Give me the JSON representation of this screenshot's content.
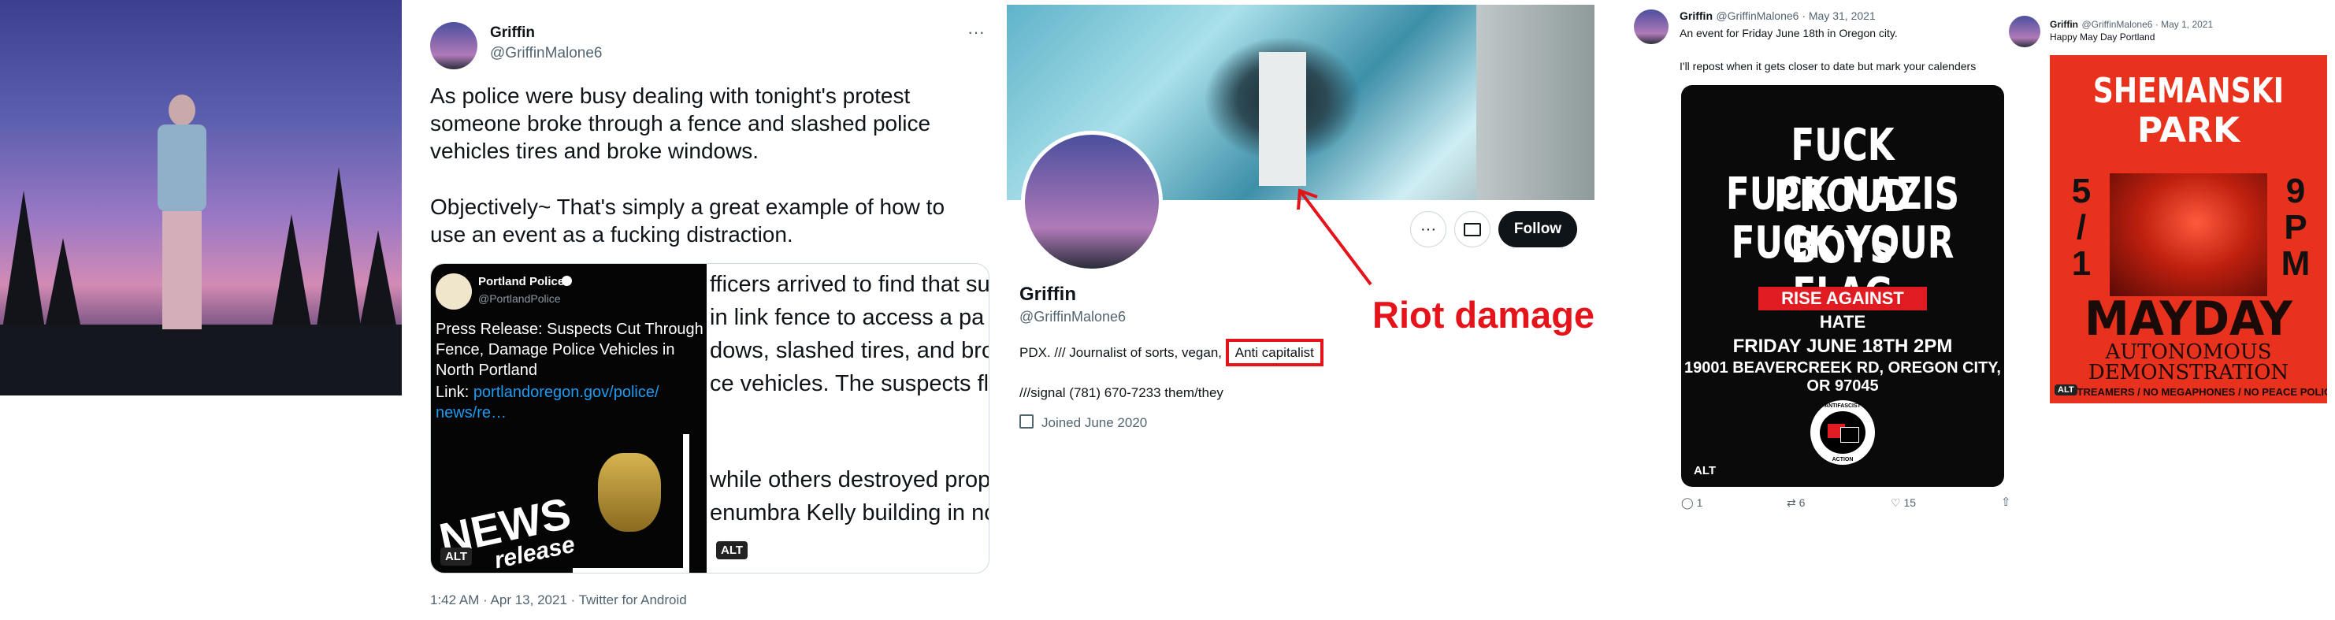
{
  "tweet": {
    "name": "Griffin",
    "handle": "@GriffinMalone6",
    "more": "···",
    "text1": "As police were busy dealing with tonight's protest someone broke through a fence and slashed police vehicles tires and broke windows.",
    "text2": "Objectively~ That's simply a great example of how to use an event as a fucking distraction.",
    "timestamp": "1:42 AM · Apr 13, 2021 · Twitter for Android",
    "embedded": {
      "name": "Portland Police",
      "handle": "@PortlandPolice",
      "title": "Press Release: Suspects Cut Through Fence, Damage Police Vehicles in North Portland",
      "link_label": "Link:",
      "link": "portlandoregon.gov/police/ news/re…",
      "news_word": "NEWS",
      "release_word": "release",
      "alt": "ALT"
    },
    "side_lines": [
      "fficers arrived to find that su",
      "in link fence to access a pa",
      "dows, slashed tires, and bro",
      "ce vehicles. The suspects fle",
      "while others destroyed prop",
      "enumbra Kelly building in no"
    ],
    "alt2": "ALT"
  },
  "profile": {
    "name": "Griffin",
    "handle": "@GriffinMalone6",
    "bio_prefix": "PDX. /// Journalist of sorts, vegan,",
    "bio_highlight": "Anti capitalist",
    "contact": "///signal (781) 670-7233 them/they",
    "joined": "Joined June 2020",
    "follow_label": "Follow",
    "more": "···",
    "annotation": "Riot damage"
  },
  "tweet2": {
    "name": "Griffin",
    "handle_date": "@GriffinMalone6 · May 31, 2021",
    "line1": "An event for Friday June 18th in Oregon city.",
    "line2": "I'll repost when it gets closer to date but mark your calenders",
    "poster": {
      "l1": "FUCK PROUD BOYS",
      "l2": "FUCK NAZIS",
      "l3": "FUCK YOUR FLAG",
      "banner": "RISE AGAINST HATE",
      "date": "FRIDAY JUNE 18TH 2PM",
      "address": "19001 BEAVERCREEK RD, OREGON CITY, OR 97045",
      "logo_top": "ANTIFASCIST",
      "logo_bottom": "ACTION",
      "alt": "ALT"
    },
    "replies": "1",
    "retweets": "6",
    "likes": "15"
  },
  "tweet3": {
    "name": "Griffin",
    "handle_date": "@GriffinMalone6 · May 1, 2021",
    "text": "Happy May Day Portland",
    "poster": {
      "title1": "SHEMANSKI",
      "title2": "PARK",
      "left_date": [
        "5",
        "/",
        "1"
      ],
      "right_time": [
        "9",
        "P",
        "M"
      ],
      "mayday": "MAYDAY",
      "sub1": "AUTONOMOUS",
      "sub2": "DEMONSTRATION",
      "footer": "STREAMERS / NO MEGAPHONES / NO PEACE POLICE",
      "alt": "ALT"
    }
  },
  "colors": {
    "accent_red": "#e5141b",
    "link_blue": "#1d9bf0",
    "poster_red": "#e8321e"
  }
}
